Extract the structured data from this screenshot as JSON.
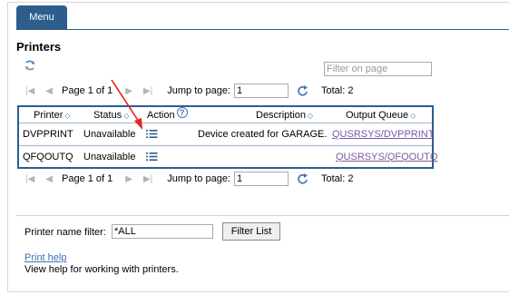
{
  "menu": {
    "label": "Menu"
  },
  "page": {
    "title": "Printers"
  },
  "toolbar": {
    "filter_placeholder": "Filter on page"
  },
  "pager": {
    "page_label": "Page 1 of 1",
    "jump_label": "Jump to page:",
    "jump_value": "1",
    "total_label": "Total: 2"
  },
  "table": {
    "headers": {
      "printer": "Printer",
      "status": "Status",
      "action": "Action",
      "description": "Description",
      "output_queue": "Output Queue"
    },
    "rows": [
      {
        "printer": "DVPPRINT",
        "status": "Unavailable",
        "description": "Device created for GARAGE.",
        "output_queue": "QUSRSYS/DVPPRINT"
      },
      {
        "printer": "QFQOUTQ",
        "status": "Unavailable",
        "description": "",
        "output_queue": "QUSRSYS/QFQOUTQ"
      }
    ]
  },
  "filter": {
    "label": "Printer name filter:",
    "value": "*ALL",
    "button": "Filter List"
  },
  "help": {
    "link": "Print help",
    "text": "View help for working with printers."
  },
  "colors": {
    "accent": "#2d5d8c",
    "link_visited": "#7f55a8",
    "link": "#3e6fb0",
    "annotation": "#e8231f"
  },
  "icons": [
    "refresh-icon",
    "first-page-icon",
    "prev-page-icon",
    "next-page-icon",
    "last-page-icon",
    "go-icon",
    "sort-icon",
    "help-icon",
    "action-list-icon",
    "annotation-arrow"
  ]
}
